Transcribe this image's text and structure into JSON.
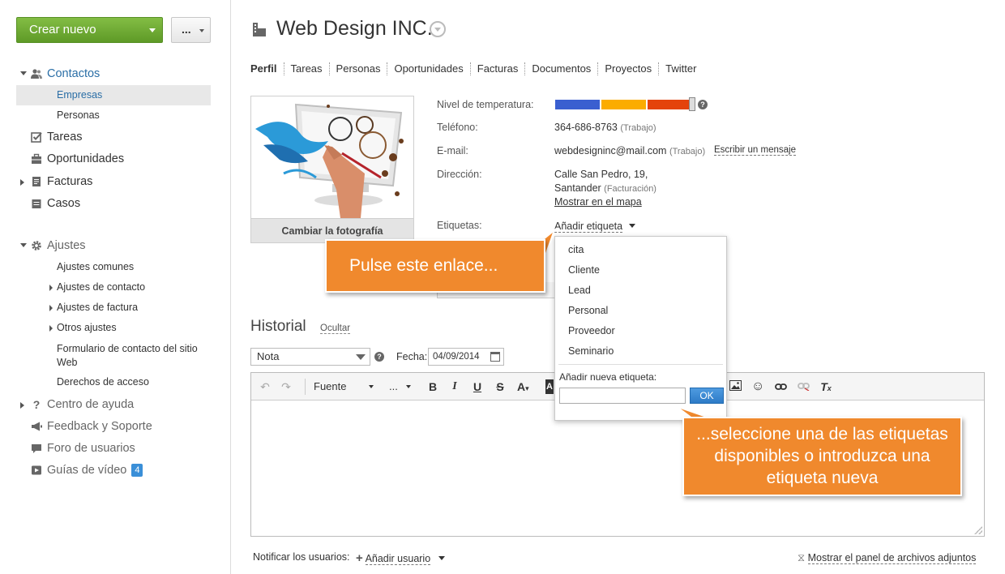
{
  "sidebar": {
    "create_label": "Crear nuevo",
    "more_label": "...",
    "contactos": "Contactos",
    "empresas": "Empresas",
    "personas": "Personas",
    "tareas": "Tareas",
    "oportunidades": "Oportunidades",
    "facturas": "Facturas",
    "casos": "Casos",
    "ajustes": "Ajustes",
    "ajustes_comunes": "Ajustes comunes",
    "ajustes_contacto": "Ajustes de contacto",
    "ajustes_factura": "Ajustes de factura",
    "otros_ajustes": "Otros ajustes",
    "formulario": "Formulario de contacto del sitio Web",
    "derechos": "Derechos de acceso",
    "centro_ayuda": "Centro de ayuda",
    "feedback": "Feedback y Soporte",
    "foro": "Foro de usuarios",
    "guias": "Guías de vídeo",
    "guias_badge": "4"
  },
  "header": {
    "title": "Web Design INC."
  },
  "tabs": [
    "Perfil",
    "Tareas",
    "Personas",
    "Oportunidades",
    "Facturas",
    "Documentos",
    "Proyectos",
    "Twitter"
  ],
  "photo": {
    "change_label": "Cambiar la fotografía"
  },
  "details": {
    "temp_label": "Nivel de temperatura:",
    "phone_label": "Teléfono:",
    "phone_value": "364-686-8763",
    "phone_type": "(Trabajo)",
    "email_label": "E-mail:",
    "email_value": "webdesigninc@mail.com",
    "email_type": "(Trabajo)",
    "email_link": "Escribir un mensaje",
    "address_label": "Dirección:",
    "address_line1": "Calle San Pedro, 19,",
    "address_line2": "Santander",
    "address_type": "(Facturación)",
    "map_link": "Mostrar en el mapa",
    "tags_label": "Etiquetas:",
    "add_tag_link": "Añadir etiqueta"
  },
  "colors": {
    "temp_cold": "#3a5fd0",
    "temp_warm": "#fbac00",
    "temp_hot": "#e4430b",
    "callout": "#f0892d",
    "create_button": "#6aa833"
  },
  "tag_dropdown": {
    "items": [
      "cita",
      "Cliente",
      "Lead",
      "Personal",
      "Proveedor",
      "Seminario"
    ],
    "new_tag_label": "Añadir nueva etiqueta:",
    "new_tag_value": "",
    "ok_label": "OK"
  },
  "history": {
    "title": "Historial",
    "hide_link": "Ocultar",
    "type_value": "Nota",
    "date_label": "Fecha:",
    "date_value": "04/09/2014",
    "font_label": "Fuente",
    "size_label": "..."
  },
  "footer": {
    "notify_label": "Notificar los usuarios:",
    "add_user": "Añadir usuario",
    "attachments_link": "Mostrar el panel de archivos adjuntos"
  },
  "callouts": {
    "first": "Pulse este enlace...",
    "second": "...seleccione una de las etiquetas disponibles o introduzca una etiqueta nueva"
  }
}
